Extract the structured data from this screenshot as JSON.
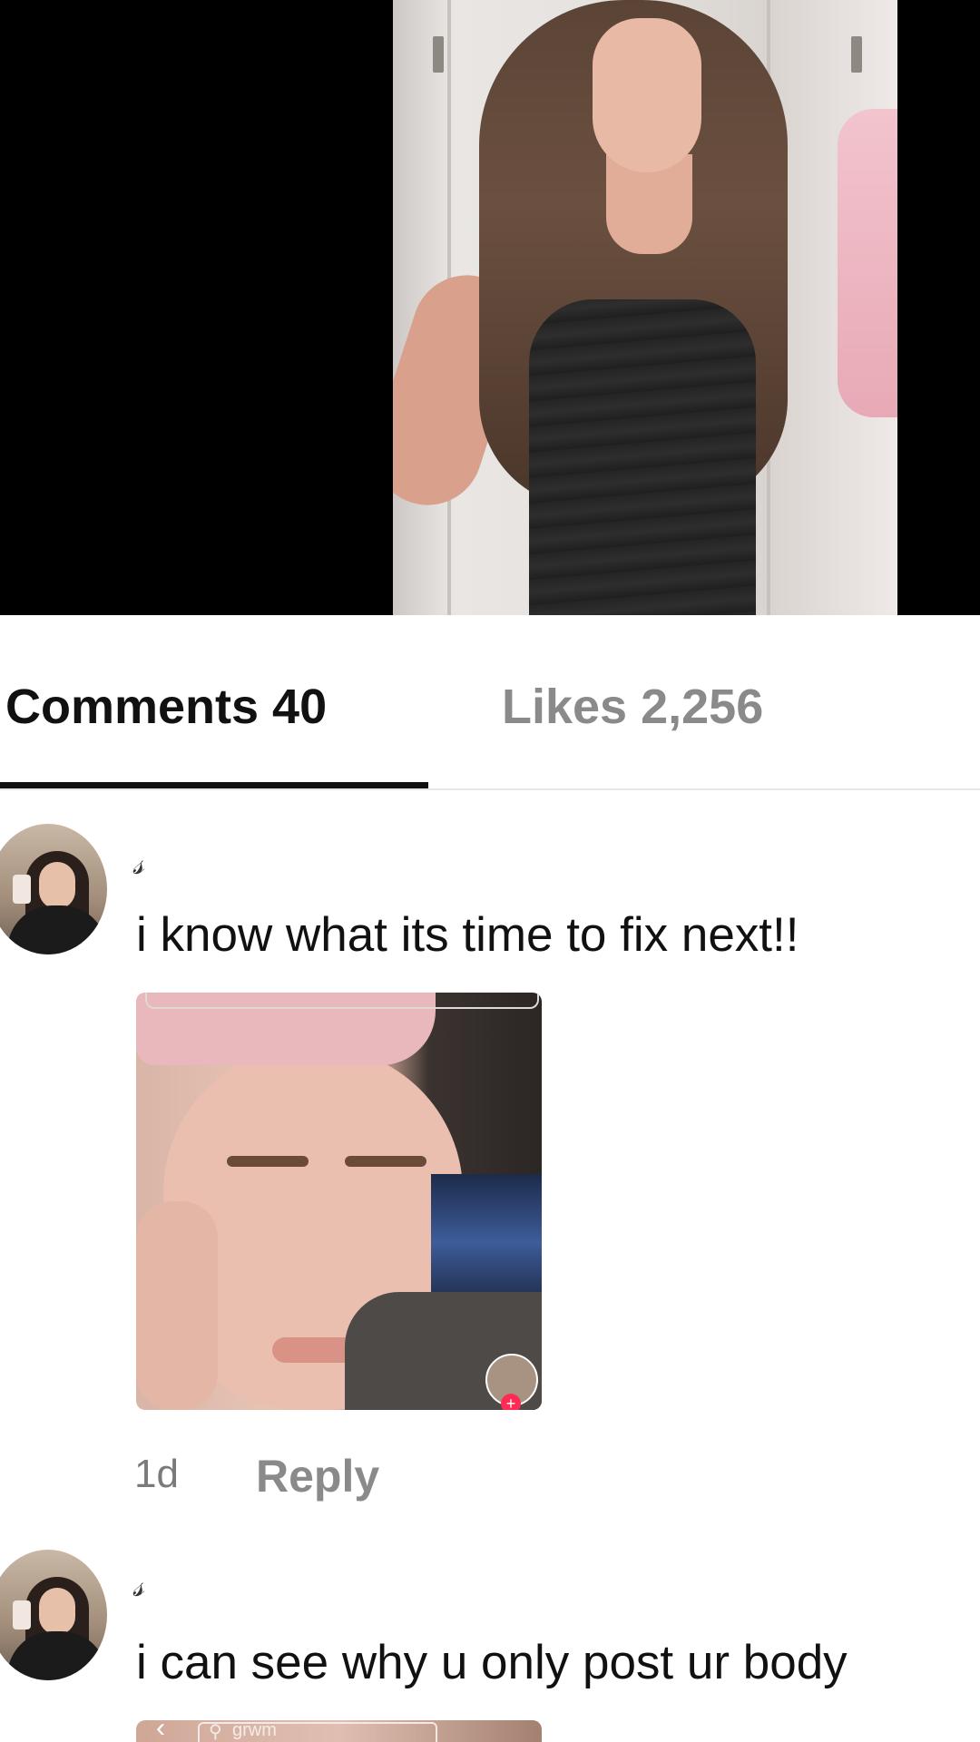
{
  "tabs": {
    "comments": "Comments 40",
    "likes": "Likes 2,256"
  },
  "comments": [
    {
      "username": "𝓈",
      "text": "i know what its time to fix next!!",
      "time": "1d",
      "reply_label": "Reply"
    },
    {
      "username": "𝓈",
      "text": "i can see why u only post ur body"
    }
  ],
  "embedded_thumb": {
    "search_text": "grwm"
  },
  "colors": {
    "accent": "#fe2c55",
    "text_primary": "#111111",
    "text_secondary": "#8a8a8a"
  }
}
